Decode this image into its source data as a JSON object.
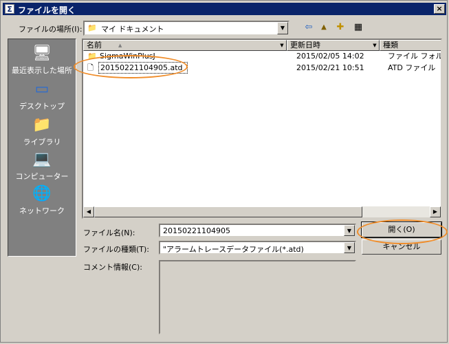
{
  "window": {
    "title": "ファイルを開く",
    "close_glyph": "×",
    "sys_glyph": "Σ"
  },
  "look_in": {
    "label": "ファイルの場所(I):",
    "value": "マイ ドキュメント"
  },
  "toolbar": {
    "back_glyph": "⇦",
    "up_glyph": "▲",
    "newfolder_glyph": "✚",
    "view_glyph": "▦"
  },
  "places": [
    {
      "label": "最近表示した場所",
      "icon": "recent-icon",
      "glyph": "🖥"
    },
    {
      "label": "デスクトップ",
      "icon": "desktop-icon",
      "glyph": "▭"
    },
    {
      "label": "ライブラリ",
      "icon": "library-icon",
      "glyph": "📁"
    },
    {
      "label": "コンピューター",
      "icon": "computer-icon",
      "glyph": "💻"
    },
    {
      "label": "ネットワーク",
      "icon": "network-icon",
      "glyph": "🌐"
    }
  ],
  "columns": {
    "name": "名前",
    "date": "更新日時",
    "type": "種類"
  },
  "files": [
    {
      "name": "SigmaWinPlusJ",
      "date": "2015/02/05 14:02",
      "type": "ファイル フォルダー",
      "icon": "folder-icon"
    },
    {
      "name": "20150221104905.atd",
      "date": "2015/02/21 10:51",
      "type": "ATD ファイル",
      "icon": "file-icon"
    }
  ],
  "filename": {
    "label": "ファイル名(N):",
    "value": "20150221104905"
  },
  "filetype": {
    "label": "ファイルの種類(T):",
    "value": "\"アラームトレースデータファイル(*.atd)"
  },
  "comment": {
    "label": "コメント情報(C):"
  },
  "buttons": {
    "open": "開く(O)",
    "cancel": "キャンセル"
  },
  "scroll": {
    "left": "◀",
    "right": "▶",
    "down": "▼",
    "sort": "▲"
  },
  "accent": "#f08c28"
}
